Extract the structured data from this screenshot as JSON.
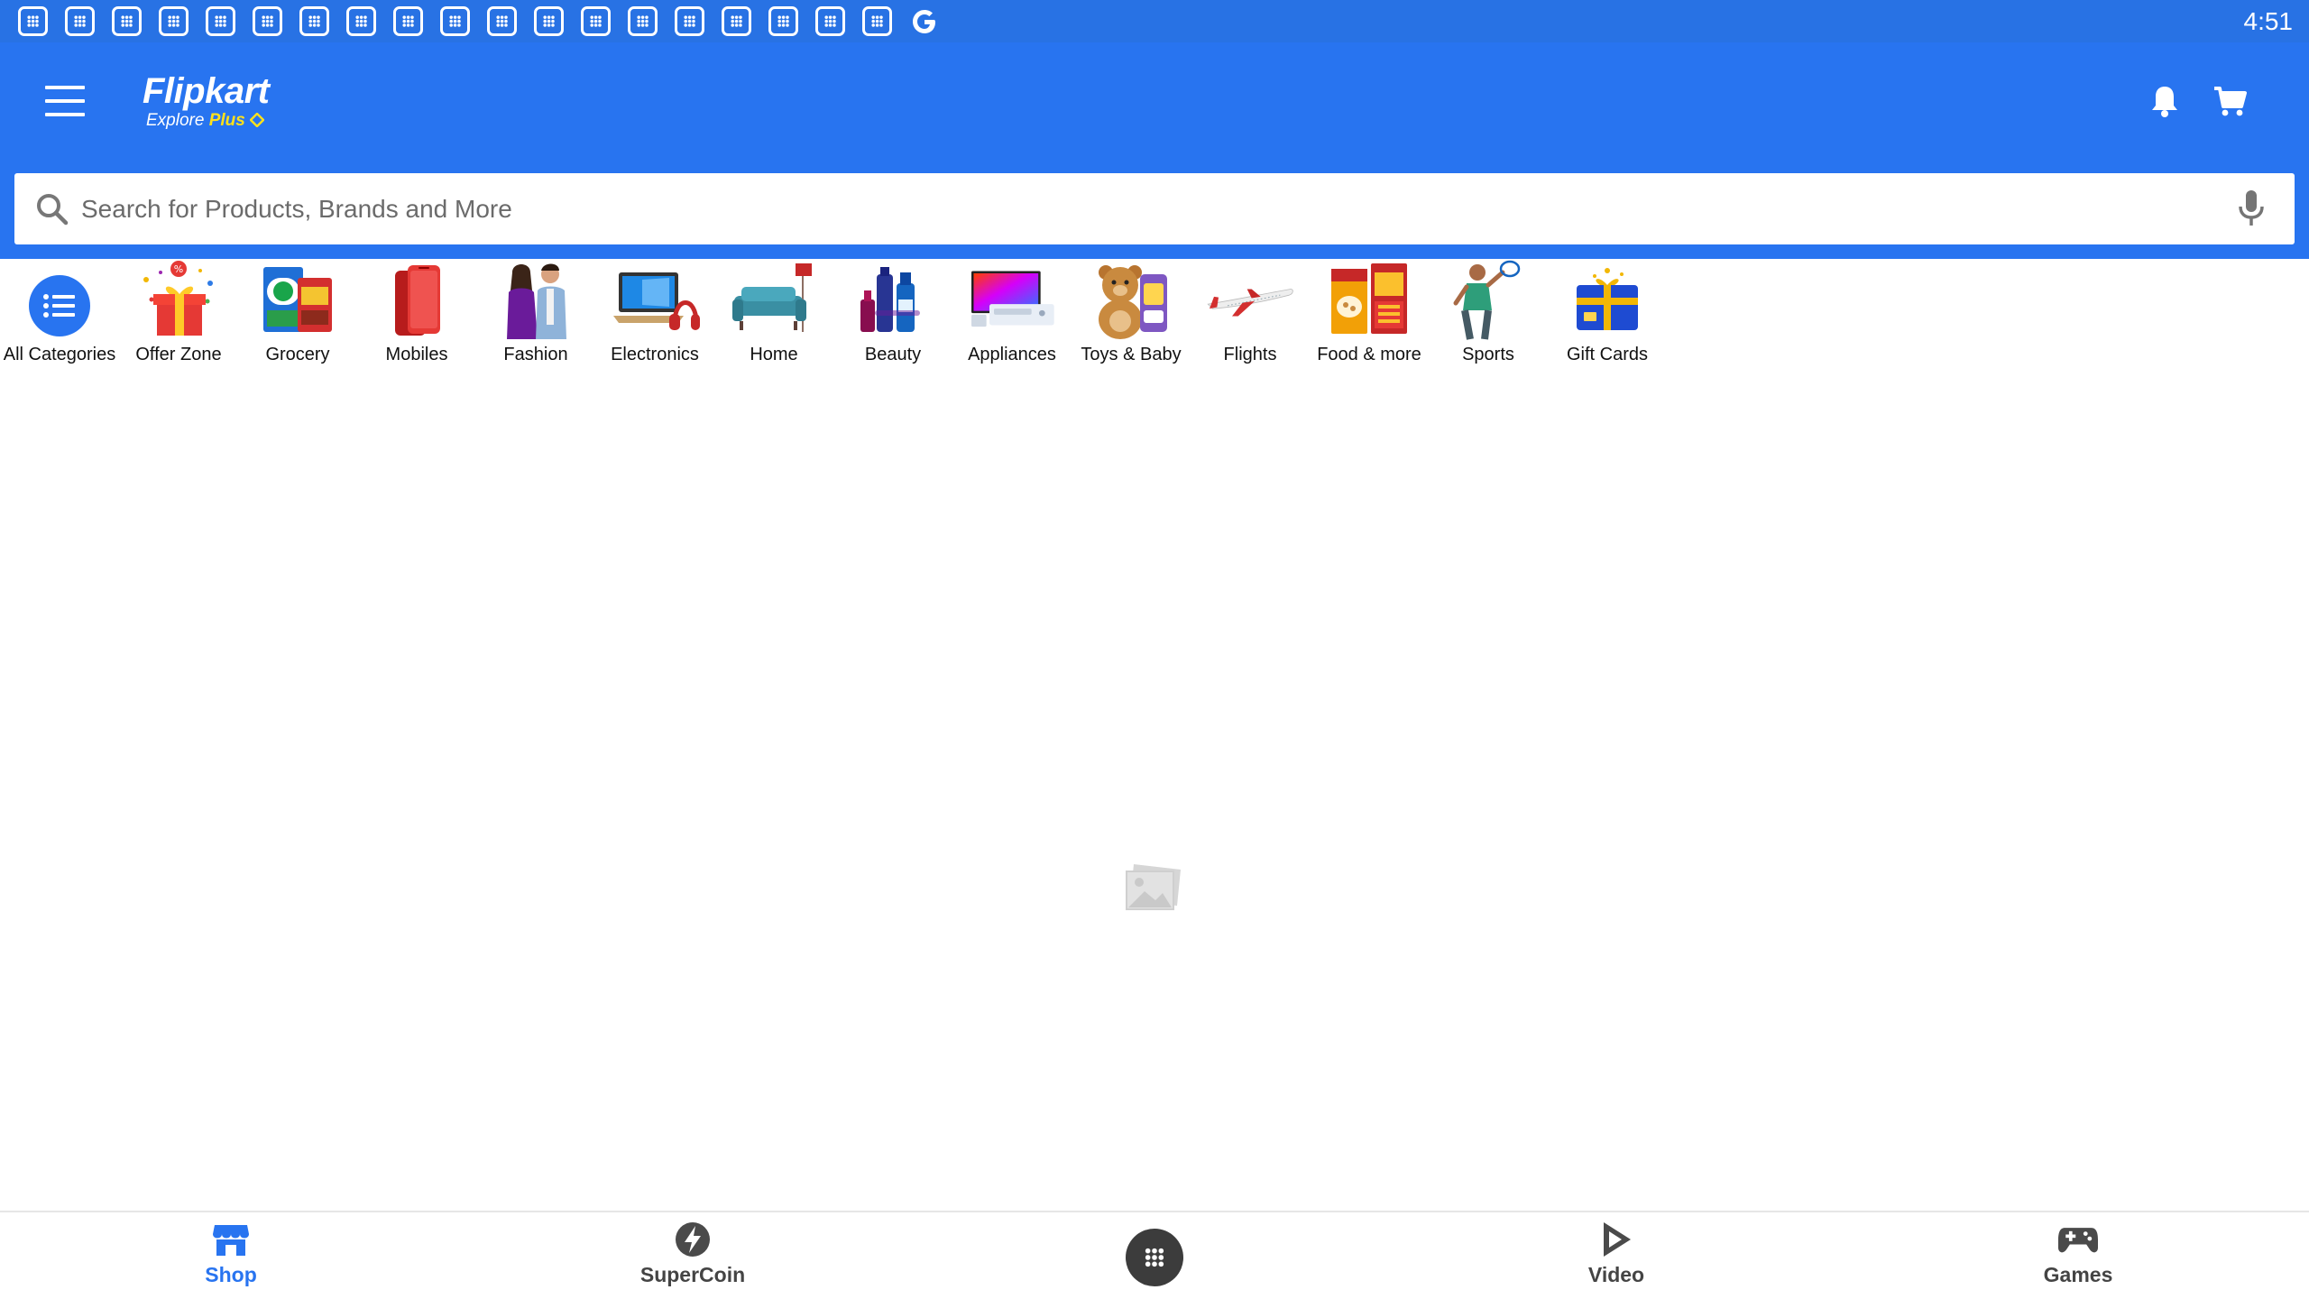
{
  "status_bar": {
    "notification_icon_count": 19,
    "google_icon": "google-g-icon",
    "time": "4:51"
  },
  "header": {
    "brand_name": "Flipkart",
    "brand_tagline": "Explore",
    "brand_tagline_plus": "Plus",
    "menu_icon": "hamburger-menu-icon",
    "bell_icon": "notification-bell-icon",
    "cart_icon": "shopping-cart-icon",
    "accent_color": "#2874f0",
    "plus_color": "#ffe11b"
  },
  "search": {
    "placeholder": "Search for Products, Brands and More",
    "value": ""
  },
  "categories": [
    {
      "label": "All Categories",
      "icon": "list-icon"
    },
    {
      "label": "Offer Zone",
      "icon": "gift-box-icon"
    },
    {
      "label": "Grocery",
      "icon": "grocery-icon"
    },
    {
      "label": "Mobiles",
      "icon": "mobile-phone-icon"
    },
    {
      "label": "Fashion",
      "icon": "fashion-models-icon"
    },
    {
      "label": "Electronics",
      "icon": "laptop-headphones-icon"
    },
    {
      "label": "Home",
      "icon": "sofa-icon"
    },
    {
      "label": "Beauty",
      "icon": "cosmetics-icon"
    },
    {
      "label": "Appliances",
      "icon": "tv-appliance-icon"
    },
    {
      "label": "Toys & Baby",
      "icon": "teddy-bear-icon"
    },
    {
      "label": "Flights",
      "icon": "airplane-icon"
    },
    {
      "label": "Food & more",
      "icon": "food-packs-icon"
    },
    {
      "label": "Sports",
      "icon": "badminton-player-icon"
    },
    {
      "label": "Gift Cards",
      "icon": "gift-card-icon"
    }
  ],
  "main": {
    "placeholder_icon": "image-placeholder-icon"
  },
  "bottom_nav": {
    "items": [
      {
        "label": "Shop",
        "icon": "shop-icon",
        "active": true
      },
      {
        "label": "SuperCoin",
        "icon": "supercoin-icon",
        "active": false
      },
      {
        "label": "Video",
        "icon": "video-play-icon",
        "active": false
      },
      {
        "label": "Games",
        "icon": "gamepad-icon",
        "active": false
      }
    ],
    "apps_icon": "app-drawer-icon"
  }
}
